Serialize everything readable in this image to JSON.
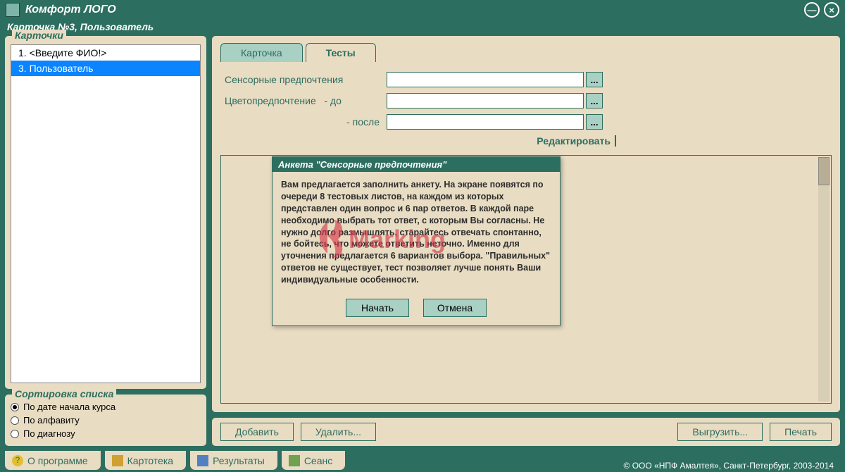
{
  "app": {
    "title": "Комфорт ЛОГО"
  },
  "subtitle": "Карточка №3, Пользователь",
  "cards": {
    "legend": "Карточки",
    "items": [
      {
        "num": "1.",
        "label": "<Введите ФИО!>"
      },
      {
        "num": "3.",
        "label": "Пользователь"
      }
    ],
    "selected": 1
  },
  "sort": {
    "legend": "Сортировка списка",
    "options": [
      "По дате начала курса",
      "По алфавиту",
      "По диагнозу"
    ],
    "selected": 0
  },
  "tabs": {
    "items": [
      "Карточка",
      "Тесты"
    ],
    "active": 1
  },
  "form": {
    "row1_label": "Сенсорные предпочтения",
    "row2_label": "Цветопредпочтение",
    "sub_before": "- до",
    "sub_after": "- после",
    "edit": "Редактировать",
    "ellipsis": "..."
  },
  "bottomButtons": {
    "add": "Добавить",
    "delete": "Удалить...",
    "export": "Выгрузить...",
    "print": "Печать"
  },
  "bottomTabs": {
    "about": "О программе",
    "cards": "Картотека",
    "results": "Результаты",
    "session": "Сеанс"
  },
  "copyright": "© ООО «НПФ Амалтея», Санкт-Петербург, 2003-2014",
  "dialog": {
    "title": "Анкета \"Сенсорные предпочтения\"",
    "body": "Вам предлагается заполнить анкету. На экране появятся по очереди 8 тестовых листов, на каждом из которых представлен один вопрос и 6 пар ответов. В каждой паре необходимо выбрать тот ответ, с которым Вы согласны. Не нужно долго размышлять, старайтесь отвечать спонтанно, не бойтесь, что можете ответить неточно. Именно для уточнения предлагается 6 вариантов выбора. \"Правильных\" ответов не существует, тест позволяет лучше понять Ваши индивидуальные особенности.",
    "start": "Начать",
    "cancel": "Отмена"
  },
  "watermark": "Marking"
}
